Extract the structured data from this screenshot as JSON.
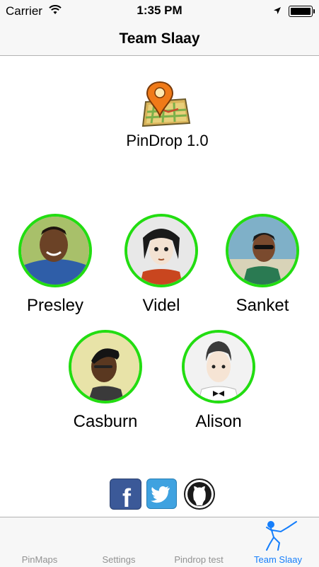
{
  "status_bar": {
    "carrier": "Carrier",
    "time": "1:35 PM"
  },
  "nav": {
    "title": "Team Slaay"
  },
  "app": {
    "name": "PinDrop 1.0",
    "icon": "map-pin-icon"
  },
  "team": [
    {
      "name": "Presley"
    },
    {
      "name": "Videl"
    },
    {
      "name": "Sanket"
    },
    {
      "name": "Casburn"
    },
    {
      "name": "Alison"
    }
  ],
  "social": [
    {
      "icon": "facebook-icon",
      "glyph": "f"
    },
    {
      "icon": "twitter-icon"
    },
    {
      "icon": "github-icon"
    }
  ],
  "tabs": [
    {
      "label": "PinMaps"
    },
    {
      "label": "Settings"
    },
    {
      "label": "Pindrop test"
    },
    {
      "label": "Team Slaay",
      "active": true
    }
  ],
  "colors": {
    "accent": "#157efb",
    "ring": "#22dd11",
    "facebook": "#3b5998",
    "twitter": "#3fa2e0"
  }
}
